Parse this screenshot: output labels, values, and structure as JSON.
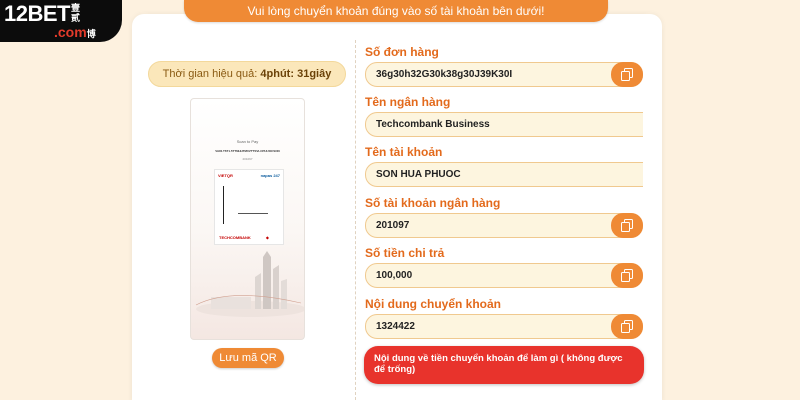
{
  "logo": {
    "main": "12BET",
    "cn_top": "壹贰",
    "sub": ".com",
    "cn_bottom": "博"
  },
  "banner": "Vui lòng chuyển khoản đúng vào số tài khoản bên dưới!",
  "timer": {
    "label": "Thời gian hiệu quả:",
    "minutes": "4phút:",
    "seconds": "31giây"
  },
  "qr": {
    "scan_text": "Scan to Pay",
    "account_line": "VADI.T6T1.5TTNHHTM0VTTSVLCPHUOCSON",
    "date": "201097",
    "vietqr": "VIETQR",
    "napas": "napas 247",
    "bank": "TECHCOMBANK"
  },
  "save_qr_label": "Lưu mã QR",
  "fields": {
    "order_no": {
      "label": "Số đơn hàng",
      "value": "36g30h32G30k38g30J39K30I"
    },
    "bank_name": {
      "label": "Tên ngân hàng",
      "value": "Techcombank Business"
    },
    "account_name": {
      "label": "Tên tài khoản",
      "value": "SON HUA PHUOC"
    },
    "account_no": {
      "label": "Số tài khoản ngân hàng",
      "value": "201097"
    },
    "amount": {
      "label": "Số tiền chi trả",
      "value": "100,000"
    },
    "content": {
      "label": "Nội dung chuyển khoản",
      "value": "1324422"
    }
  },
  "warning": "Nội dung về tiền chuyển khoản để làm gì ( không được để trống)",
  "colors": {
    "accent": "#ef8a35",
    "label": "#e36a1c",
    "field_bg": "#fdf5df",
    "warning": "#e8332c",
    "page_bg": "#fdf1df"
  },
  "icons": {
    "copy": "copy-icon"
  }
}
